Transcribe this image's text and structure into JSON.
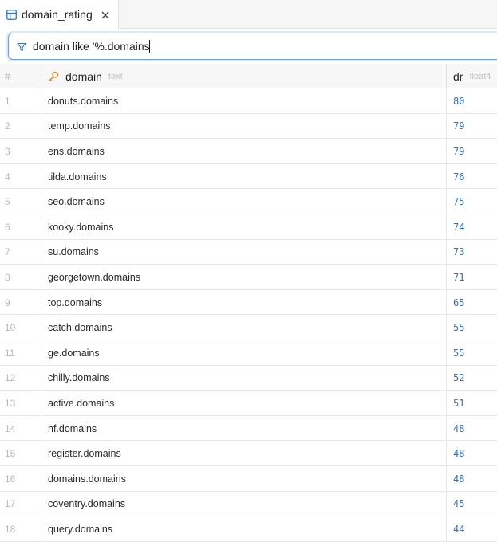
{
  "tab": {
    "title": "domain_rating",
    "icon": "table-icon",
    "close_icon": "close-icon"
  },
  "filter": {
    "value": "domain like '%.domains",
    "icon": "filter-icon"
  },
  "columns": {
    "row_num": "#",
    "domain": {
      "name": "domain",
      "type": "text",
      "icon": "key-icon"
    },
    "dr": {
      "name": "dr",
      "type": "float4"
    }
  },
  "rows": [
    {
      "n": "1",
      "domain": "donuts.domains",
      "dr": "80"
    },
    {
      "n": "2",
      "domain": "temp.domains",
      "dr": "79"
    },
    {
      "n": "3",
      "domain": "ens.domains",
      "dr": "79"
    },
    {
      "n": "4",
      "domain": "tilda.domains",
      "dr": "76"
    },
    {
      "n": "5",
      "domain": "seo.domains",
      "dr": "75"
    },
    {
      "n": "6",
      "domain": "kooky.domains",
      "dr": "74"
    },
    {
      "n": "7",
      "domain": "su.domains",
      "dr": "73"
    },
    {
      "n": "8",
      "domain": "georgetown.domains",
      "dr": "71"
    },
    {
      "n": "9",
      "domain": "top.domains",
      "dr": "65"
    },
    {
      "n": "10",
      "domain": "catch.domains",
      "dr": "55"
    },
    {
      "n": "11",
      "domain": "ge.domains",
      "dr": "55"
    },
    {
      "n": "12",
      "domain": "chilly.domains",
      "dr": "52"
    },
    {
      "n": "13",
      "domain": "active.domains",
      "dr": "51"
    },
    {
      "n": "14",
      "domain": "nf.domains",
      "dr": "48"
    },
    {
      "n": "15",
      "domain": "register.domains",
      "dr": "48"
    },
    {
      "n": "16",
      "domain": "domains.domains",
      "dr": "48"
    },
    {
      "n": "17",
      "domain": "coventry.domains",
      "dr": "45"
    },
    {
      "n": "18",
      "domain": "query.domains",
      "dr": "44"
    }
  ],
  "colors": {
    "accent": "#3570c4",
    "focus_border": "#6d9ef0",
    "key_icon": "#d08a2c"
  }
}
